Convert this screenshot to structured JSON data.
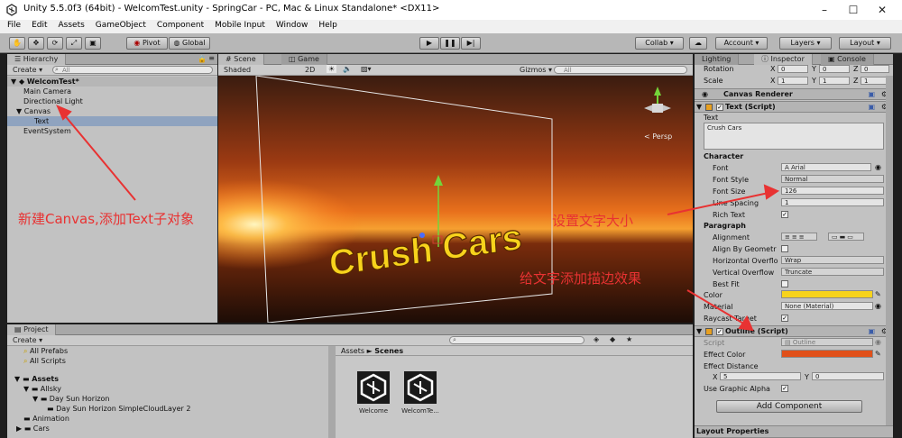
{
  "window": {
    "title": "Unity 5.5.0f3 (64bit) - WelcomTest.unity - SpringCar - PC, Mac & Linux Standalone* <DX11>"
  },
  "menu": [
    "File",
    "Edit",
    "Assets",
    "GameObject",
    "Component",
    "Mobile Input",
    "Window",
    "Help"
  ],
  "toolbar": {
    "pivot": "Pivot",
    "global": "Global",
    "collab": "Collab ▾",
    "account": "Account",
    "layers": "Layers",
    "layout": "Layout"
  },
  "hierarchy": {
    "tab": "Hierarchy",
    "create": "Create ▾",
    "search": "All",
    "scene": "WelcomTest*",
    "items": [
      {
        "label": "Main Camera"
      },
      {
        "label": "Directional Light"
      },
      {
        "label": "Canvas"
      },
      {
        "label": "Text"
      },
      {
        "label": "EventSystem"
      }
    ]
  },
  "scene": {
    "tab_scene": "Scene",
    "tab_game": "Game",
    "shading": "Shaded",
    "mode2d": "2D",
    "gizmos": "Gizmos ▾",
    "search": "All",
    "persp": "< Persp",
    "canvas_text": "Crush Cars"
  },
  "project": {
    "tab": "Project",
    "create": "Create ▾",
    "favorites": [
      "All Prefabs",
      "All Scripts"
    ],
    "tree": [
      "Assets",
      "Allsky",
      "Day Sun Horizon",
      "Day Sun Horizon SimpleCloudLayer 2",
      "Animation",
      "Cars"
    ],
    "breadcrumb_root": "Assets",
    "breadcrumb_sep": "►",
    "breadcrumb_leaf": "Scenes",
    "files": [
      {
        "name": "Welcome"
      },
      {
        "name": "WelcomTe..."
      }
    ]
  },
  "inspector": {
    "tab_lighting": "Lighting",
    "tab_inspector": "Inspector",
    "tab_console": "Console",
    "rotation": {
      "label": "Rotation",
      "x": "0",
      "y": "0",
      "z": "0"
    },
    "scale": {
      "label": "Scale",
      "x": "1",
      "y": "1",
      "z": "1"
    },
    "canvas_renderer": "Canvas Renderer",
    "text_script": "Text (Script)",
    "text_label": "Text",
    "text_value": "Crush Cars",
    "character": "Character",
    "font": {
      "label": "Font",
      "value": "Arial"
    },
    "font_style": {
      "label": "Font Style",
      "value": "Normal"
    },
    "font_size": {
      "label": "Font Size",
      "value": "126"
    },
    "line_spacing": {
      "label": "Line Spacing",
      "value": "1"
    },
    "rich_text": "Rich Text",
    "paragraph": "Paragraph",
    "alignment": "Alignment",
    "align_by_geometry": "Align By Geometr",
    "horizontal_overflow": {
      "label": "Horizontal Overflo",
      "value": "Wrap"
    },
    "vertical_overflow": {
      "label": "Vertical Overflow",
      "value": "Truncate"
    },
    "best_fit": "Best Fit",
    "color": "Color",
    "material": {
      "label": "Material",
      "value": "None (Material)"
    },
    "raycast_target": "Raycast Target",
    "outline_script": "Outline (Script)",
    "script": {
      "label": "Script",
      "value": "Outline"
    },
    "effect_color": "Effect Color",
    "effect_distance": {
      "label": "Effect Distance",
      "x": "5",
      "y": "0"
    },
    "use_graphic_alpha": "Use Graphic Alpha",
    "add_component": "Add Component",
    "layout_properties": "Layout Properties",
    "text_color": "#f7d31c",
    "effect_color_hex": "#e0501a"
  },
  "annotations": {
    "a1": "新建Canvas,添加Text子对象",
    "a2": "设置文字大小",
    "a3": "给文字添加描边效果",
    "color": "#e83232"
  }
}
